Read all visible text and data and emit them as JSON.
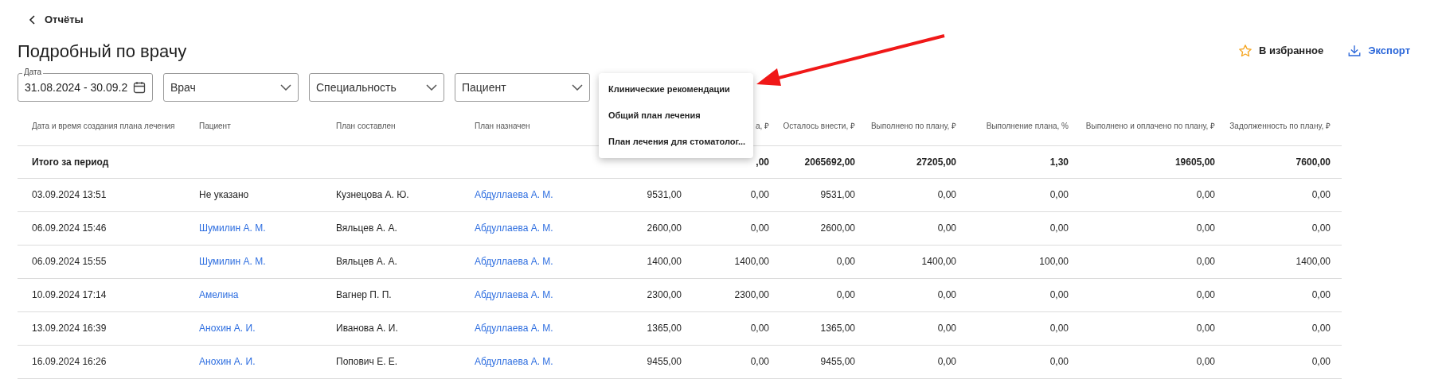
{
  "back": {
    "label": "Отчёты"
  },
  "title": "Подробный по врачу",
  "actions": [
    {
      "kind": "favorite",
      "label": "В избранное"
    },
    {
      "kind": "export",
      "label": "Экспорт"
    }
  ],
  "filters": [
    {
      "kind": "date",
      "label": "Дата",
      "value": "31.08.2024 - 30.09.2"
    },
    {
      "kind": "select",
      "placeholder": "Врач"
    },
    {
      "kind": "select",
      "placeholder": "Специальность"
    },
    {
      "kind": "select",
      "placeholder": "Пациент"
    }
  ],
  "dropdown": {
    "items": [
      "Клинические рекомендации",
      "Общий план лечения",
      "План лечения для стоматолог..."
    ]
  },
  "table": {
    "columns": [
      "Дата и время создания плана лечения",
      "Пациент",
      "План составлен",
      "План назначен",
      null,
      "а, ₽",
      "Осталось внести, ₽",
      "Выполнено по плану, ₽",
      "Выполнение плана, %",
      "Выполнено и оплачено по плану, ₽",
      "Задолженность по плану, ₽"
    ],
    "total": {
      "label": "Итого за период",
      "values": [
        ",00",
        "2065692,00",
        "27205,00",
        "1,30",
        "19605,00",
        "7600,00"
      ]
    },
    "rows": [
      {
        "cells": [
          {
            "kind": "text",
            "text": "03.09.2024 13:51"
          },
          {
            "kind": "text",
            "text": "Не указано"
          },
          {
            "kind": "text",
            "text": "Кузнецова А. Ю."
          },
          {
            "kind": "link",
            "text": "Абдуллаева А. М."
          },
          {
            "kind": "text",
            "text": "9531,00"
          },
          {
            "kind": "text",
            "text": "0,00"
          },
          {
            "kind": "text",
            "text": "9531,00"
          },
          {
            "kind": "text",
            "text": "0,00"
          },
          {
            "kind": "text",
            "text": "0,00"
          },
          {
            "kind": "text",
            "text": "0,00"
          },
          {
            "kind": "text",
            "text": "0,00"
          }
        ]
      },
      {
        "cells": [
          {
            "kind": "text",
            "text": "06.09.2024 15:46"
          },
          {
            "kind": "link",
            "text": "Шумилин А. М."
          },
          {
            "kind": "text",
            "text": "Вяльцев А. А."
          },
          {
            "kind": "link",
            "text": "Абдуллаева А. М."
          },
          {
            "kind": "text",
            "text": "2600,00"
          },
          {
            "kind": "text",
            "text": "0,00"
          },
          {
            "kind": "text",
            "text": "2600,00"
          },
          {
            "kind": "text",
            "text": "0,00"
          },
          {
            "kind": "text",
            "text": "0,00"
          },
          {
            "kind": "text",
            "text": "0,00"
          },
          {
            "kind": "text",
            "text": "0,00"
          }
        ]
      },
      {
        "cells": [
          {
            "kind": "text",
            "text": "06.09.2024 15:55"
          },
          {
            "kind": "link",
            "text": "Шумилин А. М."
          },
          {
            "kind": "text",
            "text": "Вяльцев А. А."
          },
          {
            "kind": "link",
            "text": "Абдуллаева А. М."
          },
          {
            "kind": "text",
            "text": "1400,00"
          },
          {
            "kind": "text",
            "text": "1400,00"
          },
          {
            "kind": "text",
            "text": "0,00"
          },
          {
            "kind": "text",
            "text": "1400,00"
          },
          {
            "kind": "text",
            "text": "100,00"
          },
          {
            "kind": "text",
            "text": "0,00"
          },
          {
            "kind": "text",
            "text": "1400,00"
          }
        ]
      },
      {
        "cells": [
          {
            "kind": "text",
            "text": "10.09.2024 17:14"
          },
          {
            "kind": "link",
            "text": "Амелина"
          },
          {
            "kind": "text",
            "text": "Вагнер П. П."
          },
          {
            "kind": "link",
            "text": "Абдуллаева А. М."
          },
          {
            "kind": "text",
            "text": "2300,00"
          },
          {
            "kind": "text",
            "text": "2300,00"
          },
          {
            "kind": "text",
            "text": "0,00"
          },
          {
            "kind": "text",
            "text": "0,00"
          },
          {
            "kind": "text",
            "text": "0,00"
          },
          {
            "kind": "text",
            "text": "0,00"
          },
          {
            "kind": "text",
            "text": "0,00"
          }
        ]
      },
      {
        "cells": [
          {
            "kind": "text",
            "text": "13.09.2024 16:39"
          },
          {
            "kind": "link",
            "text": "Анохин А. И."
          },
          {
            "kind": "text",
            "text": "Иванова А. И."
          },
          {
            "kind": "link",
            "text": "Абдуллаева А. М."
          },
          {
            "kind": "text",
            "text": "1365,00"
          },
          {
            "kind": "text",
            "text": "0,00"
          },
          {
            "kind": "text",
            "text": "1365,00"
          },
          {
            "kind": "text",
            "text": "0,00"
          },
          {
            "kind": "text",
            "text": "0,00"
          },
          {
            "kind": "text",
            "text": "0,00"
          },
          {
            "kind": "text",
            "text": "0,00"
          }
        ]
      },
      {
        "cells": [
          {
            "kind": "text",
            "text": "16.09.2024 16:26"
          },
          {
            "kind": "link",
            "text": "Анохин А. И."
          },
          {
            "kind": "text",
            "text": "Попович Е. Е."
          },
          {
            "kind": "link",
            "text": "Абдуллаева А. М."
          },
          {
            "kind": "text",
            "text": "9455,00"
          },
          {
            "kind": "text",
            "text": "0,00"
          },
          {
            "kind": "text",
            "text": "9455,00"
          },
          {
            "kind": "text",
            "text": "0,00"
          },
          {
            "kind": "text",
            "text": "0,00"
          },
          {
            "kind": "text",
            "text": "0,00"
          },
          {
            "kind": "text",
            "text": "0,00"
          }
        ]
      }
    ]
  }
}
